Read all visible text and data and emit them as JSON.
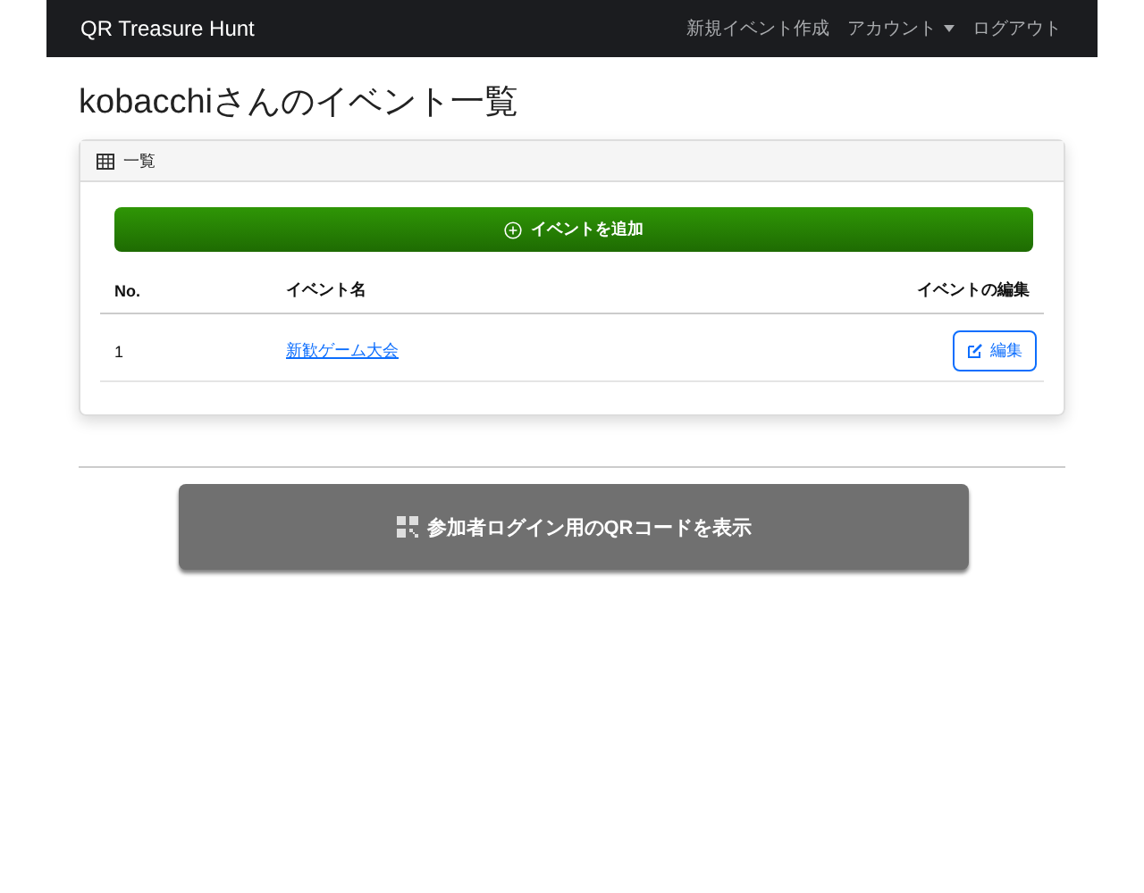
{
  "navbar": {
    "brand": "QR Treasure Hunt",
    "links": [
      {
        "label": "新規イベント作成",
        "kind": "link"
      },
      {
        "label": "アカウント",
        "kind": "dropdown"
      },
      {
        "label": "ログアウト",
        "kind": "link"
      }
    ]
  },
  "heading": "kobacchiさんのイベント一覧",
  "card": {
    "header": "一覧",
    "add_button": "イベントを追加",
    "table": {
      "columns": [
        "No.",
        "イベント名",
        "イベントの編集"
      ],
      "rows": [
        {
          "no": "1",
          "name": "新歓ゲーム大会",
          "edit": "編集"
        }
      ]
    }
  },
  "qr_button": "参加者ログイン用のQRコードを表示"
}
